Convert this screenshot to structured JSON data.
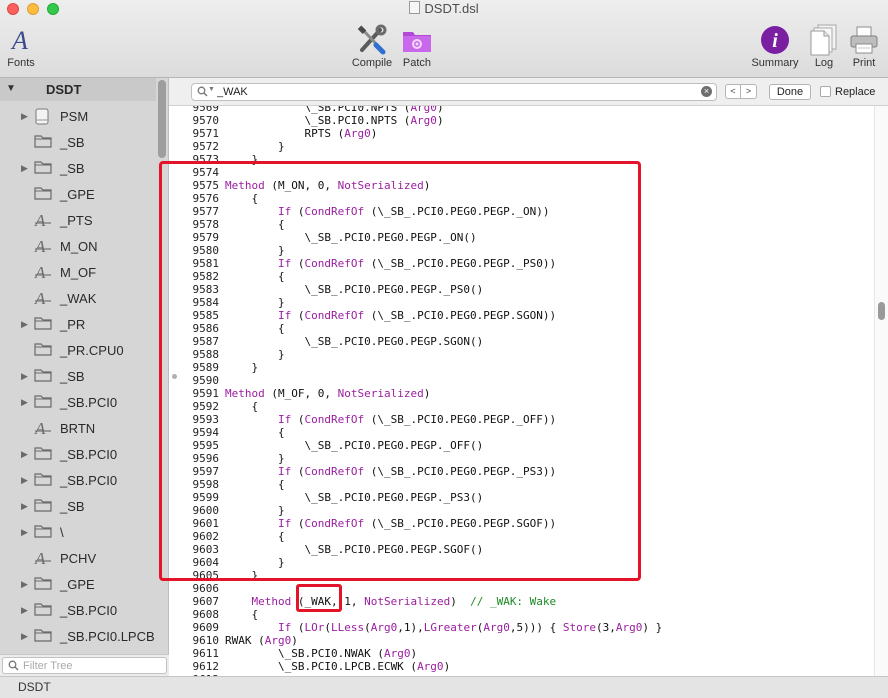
{
  "window": {
    "title": "DSDT.dsl"
  },
  "toolbar": {
    "fonts_label": "Fonts",
    "compile_label": "Compile",
    "patch_label": "Patch",
    "summary_label": "Summary",
    "log_label": "Log",
    "print_label": "Print"
  },
  "sidebar": {
    "root": "DSDT",
    "items": [
      {
        "label": "PSM",
        "icon": "device-icon",
        "disclosure": true
      },
      {
        "label": "_SB",
        "icon": "folder-icon",
        "disclosure": false
      },
      {
        "label": "_SB",
        "icon": "folder-icon",
        "disclosure": true
      },
      {
        "label": "_GPE",
        "icon": "folder-icon",
        "disclosure": false
      },
      {
        "label": "_PTS",
        "icon": "method-icon",
        "disclosure": false
      },
      {
        "label": "M_ON",
        "icon": "method-icon",
        "disclosure": false
      },
      {
        "label": "M_OF",
        "icon": "method-icon",
        "disclosure": false
      },
      {
        "label": "_WAK",
        "icon": "method-icon",
        "disclosure": false
      },
      {
        "label": "_PR",
        "icon": "folder-icon",
        "disclosure": true
      },
      {
        "label": "_PR.CPU0",
        "icon": "folder-icon",
        "disclosure": false
      },
      {
        "label": "_SB",
        "icon": "folder-icon",
        "disclosure": true
      },
      {
        "label": "_SB.PCI0",
        "icon": "folder-icon",
        "disclosure": true
      },
      {
        "label": "BRTN",
        "icon": "method-icon",
        "disclosure": false
      },
      {
        "label": "_SB.PCI0",
        "icon": "folder-icon",
        "disclosure": true
      },
      {
        "label": "_SB.PCI0",
        "icon": "folder-icon",
        "disclosure": true
      },
      {
        "label": "_SB",
        "icon": "folder-icon",
        "disclosure": true
      },
      {
        "label": "\\",
        "icon": "folder-icon",
        "disclosure": true
      },
      {
        "label": "PCHV",
        "icon": "method-icon",
        "disclosure": false
      },
      {
        "label": "_GPE",
        "icon": "folder-icon",
        "disclosure": true
      },
      {
        "label": "_SB.PCI0",
        "icon": "folder-icon",
        "disclosure": true
      },
      {
        "label": "_SB.PCI0.LPCB",
        "icon": "folder-icon",
        "disclosure": true
      }
    ],
    "filter_placeholder": "Filter Tree"
  },
  "status": {
    "text": "DSDT"
  },
  "search": {
    "value": "_WAK",
    "prev": "<",
    "next": ">",
    "done_label": "Done",
    "replace_label": "Replace"
  },
  "editor": {
    "lines": [
      {
        "n": "9569",
        "code": "            \\_SB.PCI0.NPTS (Arg0)"
      },
      {
        "n": "9570",
        "code": "            \\_SB.PCI0.NPTS (Arg0)"
      },
      {
        "n": "9571",
        "code": "            RPTS (Arg0)"
      },
      {
        "n": "9572",
        "code": "        }"
      },
      {
        "n": "9573",
        "code": "    }"
      },
      {
        "n": "9574",
        "code": ""
      },
      {
        "n": "9575",
        "code": "Method (M_ON, 0, NotSerialized)"
      },
      {
        "n": "9576",
        "code": "    {"
      },
      {
        "n": "9577",
        "code": "        If (CondRefOf (\\_SB_.PCI0.PEG0.PEGP._ON))"
      },
      {
        "n": "9578",
        "code": "        {"
      },
      {
        "n": "9579",
        "code": "            \\_SB_.PCI0.PEG0.PEGP._ON()"
      },
      {
        "n": "9580",
        "code": "        }"
      },
      {
        "n": "9581",
        "code": "        If (CondRefOf (\\_SB_.PCI0.PEG0.PEGP._PS0))"
      },
      {
        "n": "9582",
        "code": "        {"
      },
      {
        "n": "9583",
        "code": "            \\_SB_.PCI0.PEG0.PEGP._PS0()"
      },
      {
        "n": "9584",
        "code": "        }"
      },
      {
        "n": "9585",
        "code": "        If (CondRefOf (\\_SB_.PCI0.PEG0.PEGP.SGON))"
      },
      {
        "n": "9586",
        "code": "        {"
      },
      {
        "n": "9587",
        "code": "            \\_SB_.PCI0.PEG0.PEGP.SGON()"
      },
      {
        "n": "9588",
        "code": "        }"
      },
      {
        "n": "9589",
        "code": "    }"
      },
      {
        "n": "9590",
        "code": ""
      },
      {
        "n": "9591",
        "code": "Method (M_OF, 0, NotSerialized)"
      },
      {
        "n": "9592",
        "code": "    {"
      },
      {
        "n": "9593",
        "code": "        If (CondRefOf (\\_SB_.PCI0.PEG0.PEGP._OFF))"
      },
      {
        "n": "9594",
        "code": "        {"
      },
      {
        "n": "9595",
        "code": "            \\_SB_.PCI0.PEG0.PEGP._OFF()"
      },
      {
        "n": "9596",
        "code": "        }"
      },
      {
        "n": "9597",
        "code": "        If (CondRefOf (\\_SB_.PCI0.PEG0.PEGP._PS3))"
      },
      {
        "n": "9598",
        "code": "        {"
      },
      {
        "n": "9599",
        "code": "            \\_SB_.PCI0.PEG0.PEGP._PS3()"
      },
      {
        "n": "9600",
        "code": "        }"
      },
      {
        "n": "9601",
        "code": "        If (CondRefOf (\\_SB_.PCI0.PEG0.PEGP.SGOF))"
      },
      {
        "n": "9602",
        "code": "        {"
      },
      {
        "n": "9603",
        "code": "            \\_SB_.PCI0.PEG0.PEGP.SGOF()"
      },
      {
        "n": "9604",
        "code": "        }"
      },
      {
        "n": "9605",
        "code": "    }"
      },
      {
        "n": "9606",
        "code": ""
      },
      {
        "n": "9607",
        "code": "    Method (_WAK, 1, NotSerialized)  // _WAK: Wake"
      },
      {
        "n": "9608",
        "code": "    {"
      },
      {
        "n": "9609",
        "code": "        If (LOr(LLess(Arg0,1),LGreater(Arg0,5))) { Store(3,Arg0) }"
      },
      {
        "n": "9610",
        "code": "RWAK (Arg0)"
      },
      {
        "n": "9611",
        "code": "        \\_SB.PCI0.NWAK (Arg0)"
      },
      {
        "n": "9612",
        "code": "        \\_SB.PCI0.LPCB.ECWK (Arg0)"
      },
      {
        "n": "9613",
        "code": ""
      }
    ]
  },
  "colors": {
    "keyword": "#9b1ea1",
    "comment": "#1f8a24",
    "highlight": "#e3142a",
    "accent": "#7b1fa2"
  }
}
